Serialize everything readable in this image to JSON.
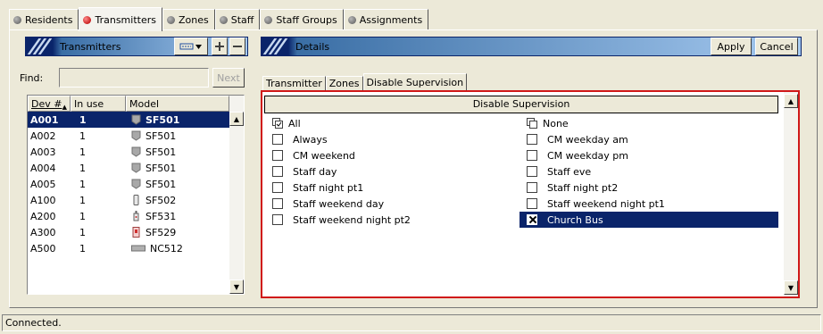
{
  "top_tabs": [
    {
      "label": "Residents",
      "active": false
    },
    {
      "label": "Transmitters",
      "active": true
    },
    {
      "label": "Zones",
      "active": false
    },
    {
      "label": "Staff",
      "active": false
    },
    {
      "label": "Staff Groups",
      "active": false
    },
    {
      "label": "Assignments",
      "active": false
    }
  ],
  "left_panel": {
    "title": "Transmitters",
    "find_label": "Find:",
    "find_value": "",
    "next_label": "Next",
    "columns": [
      "Dev #",
      "In use",
      "Model"
    ],
    "rows": [
      {
        "dev": "A001",
        "in_use": "1",
        "model": "SF501",
        "icon": "badge-icon",
        "selected": true
      },
      {
        "dev": "A002",
        "in_use": "1",
        "model": "SF501",
        "icon": "badge-icon",
        "selected": false
      },
      {
        "dev": "A003",
        "in_use": "1",
        "model": "SF501",
        "icon": "badge-icon",
        "selected": false
      },
      {
        "dev": "A004",
        "in_use": "1",
        "model": "SF501",
        "icon": "badge-icon",
        "selected": false
      },
      {
        "dev": "A005",
        "in_use": "1",
        "model": "SF501",
        "icon": "badge-icon",
        "selected": false
      },
      {
        "dev": "A100",
        "in_use": "1",
        "model": "SF502",
        "icon": "slim-tag-icon",
        "selected": false
      },
      {
        "dev": "A200",
        "in_use": "1",
        "model": "SF531",
        "icon": "pendant-icon",
        "selected": false
      },
      {
        "dev": "A300",
        "in_use": "1",
        "model": "SF529",
        "icon": "pullcord-icon",
        "selected": false
      },
      {
        "dev": "A500",
        "in_use": "1",
        "model": "NC512",
        "icon": "flat-sensor-icon",
        "selected": false
      }
    ]
  },
  "right_panel": {
    "title": "Details",
    "apply_label": "Apply",
    "cancel_label": "Cancel",
    "sub_tabs": [
      {
        "label": "Transmitter",
        "active": false
      },
      {
        "label": "Zones",
        "active": false
      },
      {
        "label": "Disable Supervision",
        "active": true
      }
    ],
    "supervision": {
      "header": "Disable Supervision",
      "all_label": "All",
      "none_label": "None",
      "left_items": [
        {
          "label": "Always",
          "checked": false
        },
        {
          "label": "CM weekend",
          "checked": false
        },
        {
          "label": "Staff day",
          "checked": false
        },
        {
          "label": "Staff night pt1",
          "checked": false
        },
        {
          "label": "Staff weekend day",
          "checked": false
        },
        {
          "label": "Staff weekend night pt2",
          "checked": false
        }
      ],
      "right_items": [
        {
          "label": "CM weekday am",
          "checked": false
        },
        {
          "label": "CM weekday pm",
          "checked": false
        },
        {
          "label": "Staff eve",
          "checked": false
        },
        {
          "label": "Staff night pt2",
          "checked": false
        },
        {
          "label": "Staff weekend night pt1",
          "checked": false
        },
        {
          "label": "Church Bus",
          "checked": true
        }
      ]
    }
  },
  "status_text": "Connected.",
  "colors": {
    "selection": "#0a246a",
    "highlight_border": "#d01818",
    "active_tab_radio": "#c01010"
  }
}
